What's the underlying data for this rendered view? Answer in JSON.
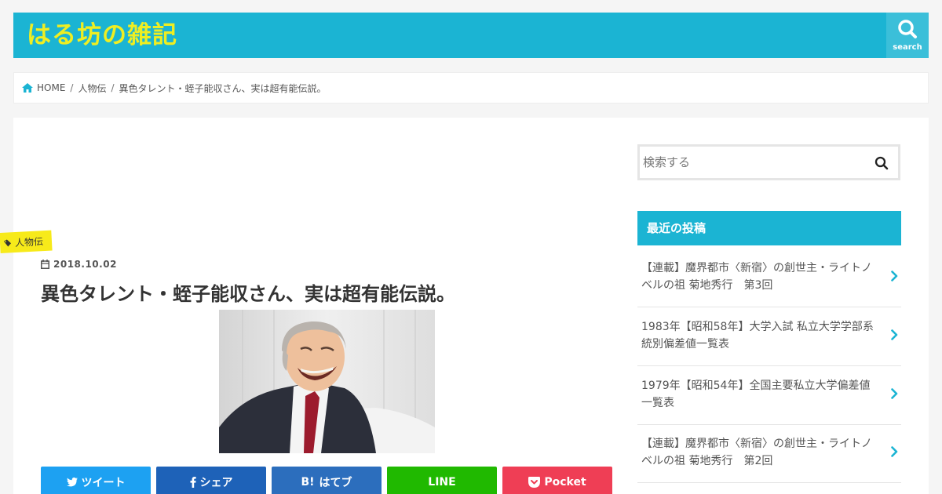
{
  "header": {
    "site_title": "はる坊の雑記",
    "search_label": "search"
  },
  "breadcrumb": {
    "home": "HOME",
    "category": "人物伝",
    "current": "異色タレント・蛭子能収さん、実は超有能伝説。"
  },
  "article": {
    "category": "人物伝",
    "date": "2018.10.02",
    "title": "異色タレント・蛭子能収さん、実は超有能伝説。"
  },
  "share": [
    {
      "label": "ツイート",
      "color": "#1da1f2",
      "icon": "twitter-icon"
    },
    {
      "label": "シェア",
      "color": "#1e62b8",
      "icon": "facebook-icon"
    },
    {
      "label": "はてブ",
      "prefix": "B!",
      "color": "#2c6ebd",
      "icon": "hatena-icon"
    },
    {
      "label": "LINE",
      "color": "#20b900",
      "icon": "line-icon"
    },
    {
      "label": "Pocket",
      "color": "#ef3e55",
      "icon": "pocket-icon"
    }
  ],
  "sidebar": {
    "search_placeholder": "検索する",
    "recent_title": "最近の投稿",
    "recent_posts": [
      "【連載】魔界都市〈新宿〉の創世主・ライトノベルの祖 菊地秀行　第3回",
      "1983年【昭和58年】大学入試 私立大学学部系統別偏差値一覧表",
      "1979年【昭和54年】全国主要私立大学偏差値一覧表",
      "【連載】魔界都市〈新宿〉の創世主・ライトノベルの祖 菊地秀行　第2回"
    ]
  },
  "colors": {
    "accent": "#1bb4d3",
    "title_yellow": "#eeee22",
    "category_yellow": "#f7ea1a"
  }
}
